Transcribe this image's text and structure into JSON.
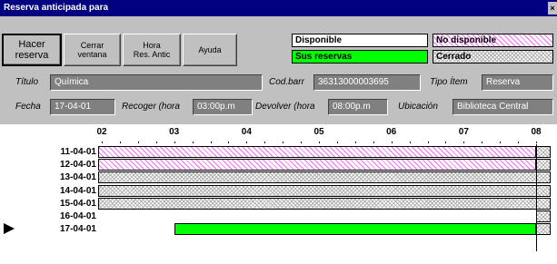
{
  "window": {
    "title": "Reserva anticipada para"
  },
  "toolbar": {
    "hacer_reserva": "Hacer\nreserva",
    "cerrar_ventana": "Cerrar\nventana",
    "hora_res": "Hora\nRes. Antic",
    "ayuda": "Ayuda"
  },
  "legend": {
    "disponible": "Disponible",
    "no_disponible": "No disponible",
    "sus_reservas": "Sus reservas",
    "cerrado": "Cerrado"
  },
  "form": {
    "titulo_label": "Título",
    "titulo_value": "Química",
    "codbarr_label": "Cod.barr",
    "codbarr_value": "36313000003695",
    "tipo_label": "Tipo Ítem",
    "tipo_value": "Reserva",
    "fecha_label": "Fecha",
    "fecha_value": "17-04-01",
    "recoger_label": "Recoger (hora",
    "recoger_value": "03:00p.m",
    "devolver_label": "Devolver (hora",
    "devolver_value": "08:00p.m",
    "ubicacion_label": "Ubicación",
    "ubicacion_value": "Biblioteca Central"
  },
  "schedule": {
    "hours": [
      "02",
      "03",
      "04",
      "05",
      "06",
      "07",
      "08"
    ],
    "rows": [
      {
        "date": "11-04-01",
        "status": "no_disponible",
        "start": 2,
        "end": 8
      },
      {
        "date": "12-04-01",
        "status": "no_disponible",
        "start": 2,
        "end": 8
      },
      {
        "date": "13-04-01",
        "status": "cerrado",
        "start": 2,
        "end": 8.3
      },
      {
        "date": "14-04-01",
        "status": "cerrado",
        "start": 2,
        "end": 8.3
      },
      {
        "date": "15-04-01",
        "status": "cerrado",
        "start": 2,
        "end": 8.3
      },
      {
        "date": "16-04-01",
        "status": "disponible",
        "start": 2,
        "end": 8
      },
      {
        "date": "17-04-01",
        "status": "sus_reservas",
        "start": 3,
        "end": 8,
        "selected": true
      }
    ]
  },
  "colors": {
    "titlebar": "#000080",
    "no_disponible": "#ff66ff",
    "sus_reservas": "#00ff00",
    "cerrado": "#b0b0b0"
  }
}
